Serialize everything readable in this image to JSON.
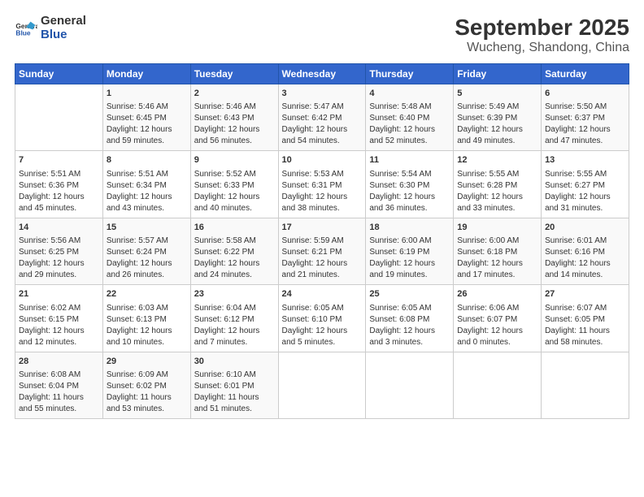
{
  "logo": {
    "general": "General",
    "blue": "Blue"
  },
  "title": "September 2025",
  "subtitle": "Wucheng, Shandong, China",
  "headers": [
    "Sunday",
    "Monday",
    "Tuesday",
    "Wednesday",
    "Thursday",
    "Friday",
    "Saturday"
  ],
  "weeks": [
    [
      {
        "day": "",
        "info": ""
      },
      {
        "day": "1",
        "info": "Sunrise: 5:46 AM\nSunset: 6:45 PM\nDaylight: 12 hours\nand 59 minutes."
      },
      {
        "day": "2",
        "info": "Sunrise: 5:46 AM\nSunset: 6:43 PM\nDaylight: 12 hours\nand 56 minutes."
      },
      {
        "day": "3",
        "info": "Sunrise: 5:47 AM\nSunset: 6:42 PM\nDaylight: 12 hours\nand 54 minutes."
      },
      {
        "day": "4",
        "info": "Sunrise: 5:48 AM\nSunset: 6:40 PM\nDaylight: 12 hours\nand 52 minutes."
      },
      {
        "day": "5",
        "info": "Sunrise: 5:49 AM\nSunset: 6:39 PM\nDaylight: 12 hours\nand 49 minutes."
      },
      {
        "day": "6",
        "info": "Sunrise: 5:50 AM\nSunset: 6:37 PM\nDaylight: 12 hours\nand 47 minutes."
      }
    ],
    [
      {
        "day": "7",
        "info": "Sunrise: 5:51 AM\nSunset: 6:36 PM\nDaylight: 12 hours\nand 45 minutes."
      },
      {
        "day": "8",
        "info": "Sunrise: 5:51 AM\nSunset: 6:34 PM\nDaylight: 12 hours\nand 43 minutes."
      },
      {
        "day": "9",
        "info": "Sunrise: 5:52 AM\nSunset: 6:33 PM\nDaylight: 12 hours\nand 40 minutes."
      },
      {
        "day": "10",
        "info": "Sunrise: 5:53 AM\nSunset: 6:31 PM\nDaylight: 12 hours\nand 38 minutes."
      },
      {
        "day": "11",
        "info": "Sunrise: 5:54 AM\nSunset: 6:30 PM\nDaylight: 12 hours\nand 36 minutes."
      },
      {
        "day": "12",
        "info": "Sunrise: 5:55 AM\nSunset: 6:28 PM\nDaylight: 12 hours\nand 33 minutes."
      },
      {
        "day": "13",
        "info": "Sunrise: 5:55 AM\nSunset: 6:27 PM\nDaylight: 12 hours\nand 31 minutes."
      }
    ],
    [
      {
        "day": "14",
        "info": "Sunrise: 5:56 AM\nSunset: 6:25 PM\nDaylight: 12 hours\nand 29 minutes."
      },
      {
        "day": "15",
        "info": "Sunrise: 5:57 AM\nSunset: 6:24 PM\nDaylight: 12 hours\nand 26 minutes."
      },
      {
        "day": "16",
        "info": "Sunrise: 5:58 AM\nSunset: 6:22 PM\nDaylight: 12 hours\nand 24 minutes."
      },
      {
        "day": "17",
        "info": "Sunrise: 5:59 AM\nSunset: 6:21 PM\nDaylight: 12 hours\nand 21 minutes."
      },
      {
        "day": "18",
        "info": "Sunrise: 6:00 AM\nSunset: 6:19 PM\nDaylight: 12 hours\nand 19 minutes."
      },
      {
        "day": "19",
        "info": "Sunrise: 6:00 AM\nSunset: 6:18 PM\nDaylight: 12 hours\nand 17 minutes."
      },
      {
        "day": "20",
        "info": "Sunrise: 6:01 AM\nSunset: 6:16 PM\nDaylight: 12 hours\nand 14 minutes."
      }
    ],
    [
      {
        "day": "21",
        "info": "Sunrise: 6:02 AM\nSunset: 6:15 PM\nDaylight: 12 hours\nand 12 minutes."
      },
      {
        "day": "22",
        "info": "Sunrise: 6:03 AM\nSunset: 6:13 PM\nDaylight: 12 hours\nand 10 minutes."
      },
      {
        "day": "23",
        "info": "Sunrise: 6:04 AM\nSunset: 6:12 PM\nDaylight: 12 hours\nand 7 minutes."
      },
      {
        "day": "24",
        "info": "Sunrise: 6:05 AM\nSunset: 6:10 PM\nDaylight: 12 hours\nand 5 minutes."
      },
      {
        "day": "25",
        "info": "Sunrise: 6:05 AM\nSunset: 6:08 PM\nDaylight: 12 hours\nand 3 minutes."
      },
      {
        "day": "26",
        "info": "Sunrise: 6:06 AM\nSunset: 6:07 PM\nDaylight: 12 hours\nand 0 minutes."
      },
      {
        "day": "27",
        "info": "Sunrise: 6:07 AM\nSunset: 6:05 PM\nDaylight: 11 hours\nand 58 minutes."
      }
    ],
    [
      {
        "day": "28",
        "info": "Sunrise: 6:08 AM\nSunset: 6:04 PM\nDaylight: 11 hours\nand 55 minutes."
      },
      {
        "day": "29",
        "info": "Sunrise: 6:09 AM\nSunset: 6:02 PM\nDaylight: 11 hours\nand 53 minutes."
      },
      {
        "day": "30",
        "info": "Sunrise: 6:10 AM\nSunset: 6:01 PM\nDaylight: 11 hours\nand 51 minutes."
      },
      {
        "day": "",
        "info": ""
      },
      {
        "day": "",
        "info": ""
      },
      {
        "day": "",
        "info": ""
      },
      {
        "day": "",
        "info": ""
      }
    ]
  ]
}
